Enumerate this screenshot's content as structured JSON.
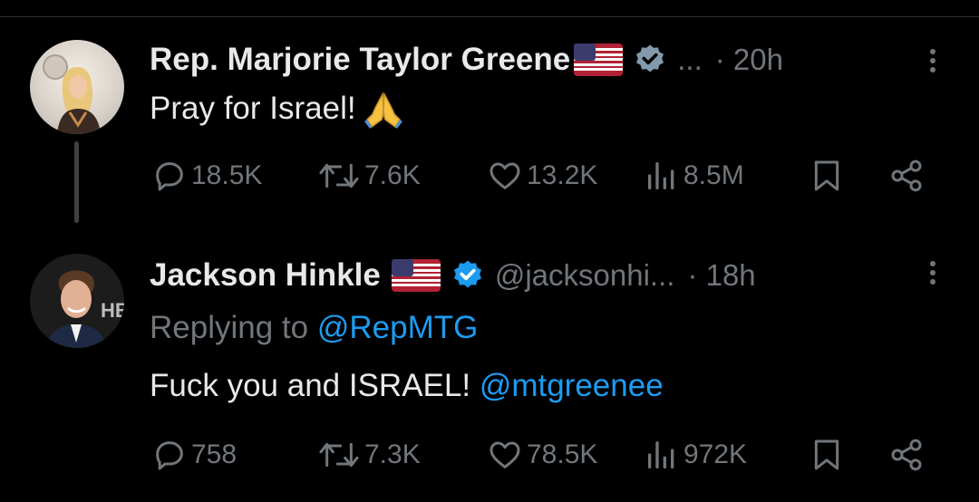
{
  "tweets": [
    {
      "name": "Rep. Marjorie Taylor Greene",
      "handle": "...",
      "time": "· 20h",
      "text": "Pray for Israel! ",
      "stats": {
        "replies": "18.5K",
        "reposts": "7.6K",
        "likes": "13.2K",
        "views": "8.5M"
      }
    },
    {
      "name": "Jackson Hinkle",
      "handle": "@jacksonhi...",
      "time": "· 18h",
      "replying_prefix": "Replying to",
      "replying_to": "@RepMTG",
      "text": "Fuck you and ISRAEL!",
      "mention": "@mtgreenee",
      "stats": {
        "replies": "758",
        "reposts": "7.3K",
        "likes": "78.5K",
        "views": "972K"
      }
    }
  ],
  "colors": {
    "background": "#000000",
    "text": "#e7e9ea",
    "muted": "#71767b",
    "link": "#1d9bf0",
    "verified_gray": "#829aab",
    "verified_blue": "#1d9bf0"
  },
  "icons": [
    "reply-icon",
    "repost-icon",
    "like-icon",
    "views-icon",
    "bookmark-icon",
    "share-icon",
    "more-icon",
    "verified-icon",
    "us-flag-icon",
    "praying-hands-emoji"
  ]
}
